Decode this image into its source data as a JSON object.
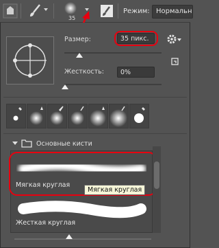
{
  "toolbar": {
    "brush_size": "35",
    "mode_label": "Режим:",
    "mode_value": "Нормальный"
  },
  "panel": {
    "size_label": "Размер:",
    "size_value": "35 пикс.",
    "hardness_label": "Жесткость:",
    "hardness_value": "0%",
    "size_slider_fraction": 0.1,
    "hardness_slider_fraction": 0.0
  },
  "brushes": {
    "folder": "Основные кисти",
    "items": [
      {
        "label": "Мягкая круглая",
        "selected": true
      },
      {
        "label": "Жесткая круглая",
        "selected": false
      }
    ],
    "tooltip": "Мягкая круглая"
  },
  "colors": {
    "highlight": "#e8000f",
    "panel_bg": "#535353"
  },
  "icons": [
    "photoshop-home-icon",
    "brush-tool-icon",
    "brush-preset-icon",
    "airbrush-icon",
    "gear-icon",
    "new-preset-icon",
    "folder-icon",
    "chevron-down-icon"
  ]
}
